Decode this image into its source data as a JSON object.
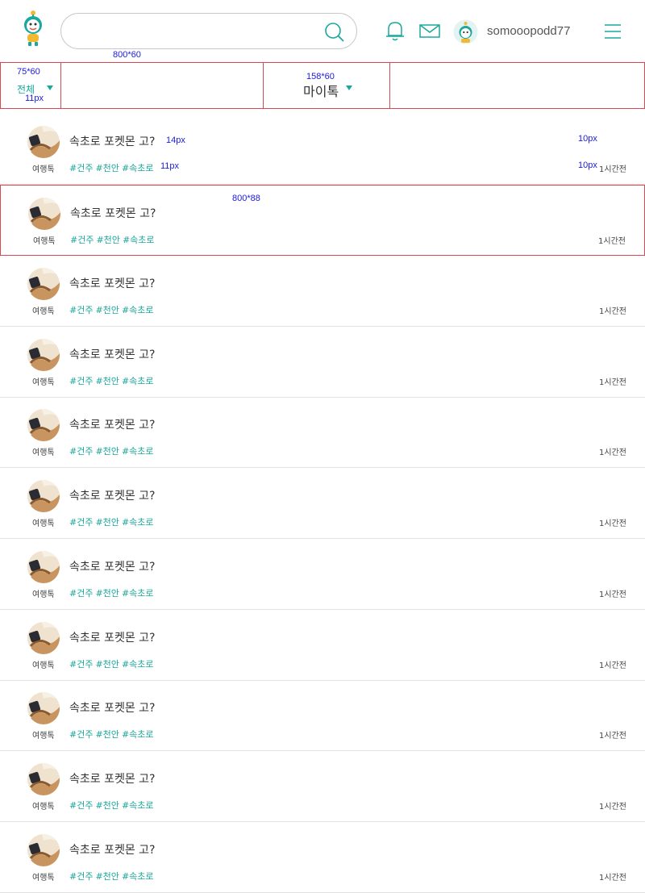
{
  "header": {
    "search_placeholder": "",
    "username": "somooopodd77"
  },
  "annotations": {
    "filterbar_size": "800*60",
    "tab_all_size": "75*60",
    "tab_all_font": "11px",
    "tab_mytalk_size": "158*60",
    "title_font": "14px",
    "time_font_right": "10px",
    "tag_font": "11px",
    "time_font": "10px",
    "row_size": "800*88"
  },
  "filter": {
    "all_label": "전체",
    "mytalk_label": "마이톡"
  },
  "posts": [
    {
      "category": "여행톡",
      "title": "속초로 포켓몬 고?",
      "tags": [
        "#건주",
        "#천안",
        "#속초로"
      ],
      "time": "1시간전"
    },
    {
      "category": "여행톡",
      "title": "속초로 포켓몬 고?",
      "tags": [
        "#건주",
        "#천안",
        "#속초로"
      ],
      "time": "1시간전"
    },
    {
      "category": "여행톡",
      "title": "속초로 포켓몬 고?",
      "tags": [
        "#건주",
        "#천안",
        "#속초로"
      ],
      "time": "1시간전"
    },
    {
      "category": "여행톡",
      "title": "속초로 포켓몬 고?",
      "tags": [
        "#건주",
        "#천안",
        "#속초로"
      ],
      "time": "1시간전"
    },
    {
      "category": "여행톡",
      "title": "속초로 포켓몬 고?",
      "tags": [
        "#건주",
        "#천안",
        "#속초로"
      ],
      "time": "1시간전"
    },
    {
      "category": "여행톡",
      "title": "속초로 포켓몬 고?",
      "tags": [
        "#건주",
        "#천안",
        "#속초로"
      ],
      "time": "1시간전"
    },
    {
      "category": "여행톡",
      "title": "속초로 포켓몬 고?",
      "tags": [
        "#건주",
        "#천안",
        "#속초로"
      ],
      "time": "1시간전"
    },
    {
      "category": "여행톡",
      "title": "속초로 포켓몬 고?",
      "tags": [
        "#건주",
        "#천안",
        "#속초로"
      ],
      "time": "1시간전"
    },
    {
      "category": "여행톡",
      "title": "속초로 포켓몬 고?",
      "tags": [
        "#건주",
        "#천안",
        "#속초로"
      ],
      "time": "1시간전"
    },
    {
      "category": "여행톡",
      "title": "속초로 포켓몬 고?",
      "tags": [
        "#건주",
        "#천안",
        "#속초로"
      ],
      "time": "1시간전"
    },
    {
      "category": "여행톡",
      "title": "속초로 포켓몬 고?",
      "tags": [
        "#건주",
        "#천안",
        "#속초로"
      ],
      "time": "1시간전"
    }
  ],
  "colors": {
    "accent": "#19a89b",
    "highlight_border": "#d9474f",
    "annotation": "#1a1ae0"
  },
  "icons": [
    "robot-logo-icon",
    "search-icon",
    "bell-icon",
    "mail-icon",
    "user-avatar-icon",
    "hamburger-menu-icon",
    "dropdown-triangle-icon"
  ]
}
